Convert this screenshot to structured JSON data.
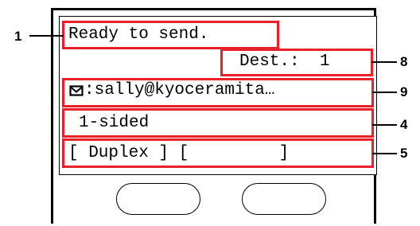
{
  "lcd": {
    "status_message": "Ready to send.",
    "destination_count": "Dest.:  1",
    "email_address": ":sally@kyoceramita…",
    "sided_setting": "1-sided",
    "soft_keys_text": "[ Duplex ] [         ]"
  },
  "callouts": {
    "status_message": "1",
    "destination_count": "8",
    "email_address": "9",
    "sided_setting": "4",
    "soft_keys": "5"
  },
  "icons": {
    "email": "envelope-icon"
  },
  "colors": {
    "callout_box": "#e8202a",
    "lines": "#000000",
    "background": "#ffffff"
  }
}
